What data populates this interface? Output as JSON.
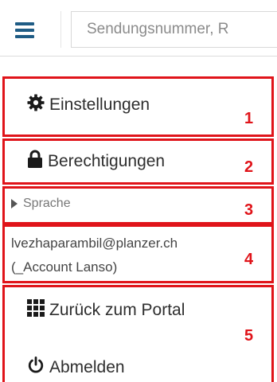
{
  "search": {
    "placeholder": "Sendungsnummer, R"
  },
  "menu": {
    "settings_label": "Einstellungen",
    "permissions_label": "Berechtigungen",
    "language_label": "Sprache",
    "account_email": "lvezhaparambil@planzer.ch",
    "account_name": "(_Account Lanso)",
    "portal_label": "Zurück zum Portal",
    "logout_label": "Abmelden"
  },
  "annotations": {
    "n1": "1",
    "n2": "2",
    "n3": "3",
    "n4": "4",
    "n5": "5"
  },
  "colors": {
    "annotation_red": "#e0141a",
    "hamburger_blue": "#1f5c85",
    "text": "#2e2e2e"
  },
  "icons": [
    "menu-icon",
    "gear-icon",
    "lock-icon",
    "caret-right-icon",
    "grid-icon",
    "power-icon"
  ]
}
